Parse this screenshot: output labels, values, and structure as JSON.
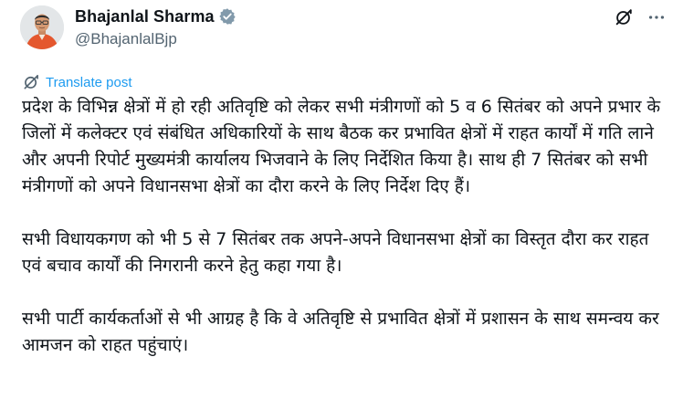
{
  "author": {
    "display_name": "Bhajanlal Sharma",
    "handle": "@BhajanlalBjp",
    "verified": true,
    "verified_icon": "verified-badge-icon",
    "badge_color": "#829aab"
  },
  "actions": {
    "grok_icon": "grok-icon",
    "more_icon": "more-horizontal-icon"
  },
  "translate": {
    "icon": "translate-icon",
    "label": "Translate post",
    "color": "#1d9bf0"
  },
  "post": {
    "paragraphs": [
      "प्रदेश के विभिन्न क्षेत्रों में हो रही अतिवृष्टि को लेकर सभी मंत्रीगणों को 5 व 6 सितंबर को अपने प्रभार के जिलों में कलेक्टर एवं संबंधित अधिकारियों के साथ बैठक कर प्रभावित क्षेत्रों में राहत कार्यों में गति लाने और अपनी रिपोर्ट मुख्यमंत्री कार्यालय भिजवाने के लिए निर्देशित किया है। साथ ही 7 सितंबर को सभी मंत्रीगणों को अपने विधानसभा क्षेत्रों का दौरा करने के लिए निर्देश दिए हैं।",
      "सभी विधायकगण को भी 5 से 7 सितंबर तक अपने-अपने विधानसभा क्षेत्रों का विस्तृत दौरा कर राहत एवं बचाव कार्यों की निगरानी करने हेतु कहा गया है।",
      "सभी पार्टी कार्यकर्ताओं से भी आग्रह है कि वे अतिवृष्टि से प्रभावित क्षेत्रों में प्रशासन के साथ समन्वय कर आमजन को राहत पहुंचाएं।"
    ]
  }
}
